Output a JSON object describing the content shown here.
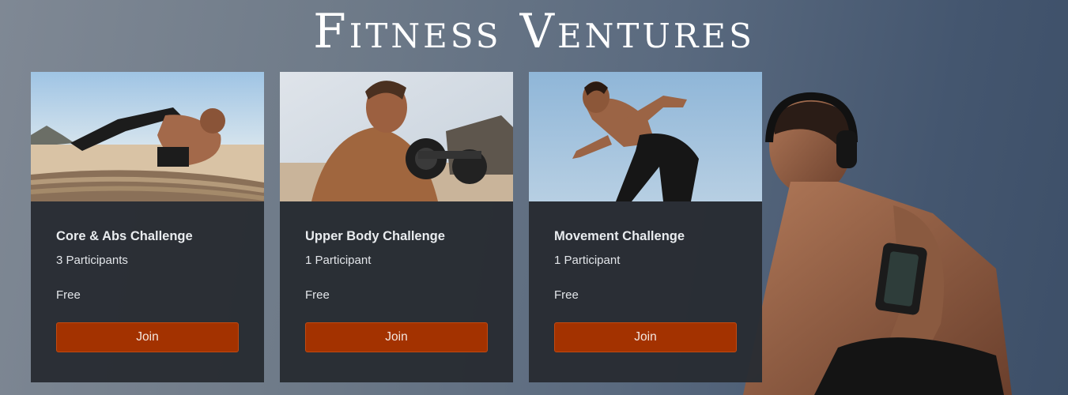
{
  "header": {
    "title": "Fitness Ventures"
  },
  "colors": {
    "accent": "#a33200",
    "card_bg": "#282c33",
    "text": "#e9ecef"
  },
  "challenges": [
    {
      "title": "Core & Abs Challenge",
      "participants": "3 Participants",
      "price": "Free",
      "button": "Join",
      "image": "beach-crunch-photo"
    },
    {
      "title": "Upper Body Challenge",
      "participants": "1 Participant",
      "price": "Free",
      "button": "Join",
      "image": "kettlebell-photo"
    },
    {
      "title": "Movement Challenge",
      "participants": "1 Participant",
      "price": "Free",
      "button": "Join",
      "image": "runner-photo"
    }
  ]
}
